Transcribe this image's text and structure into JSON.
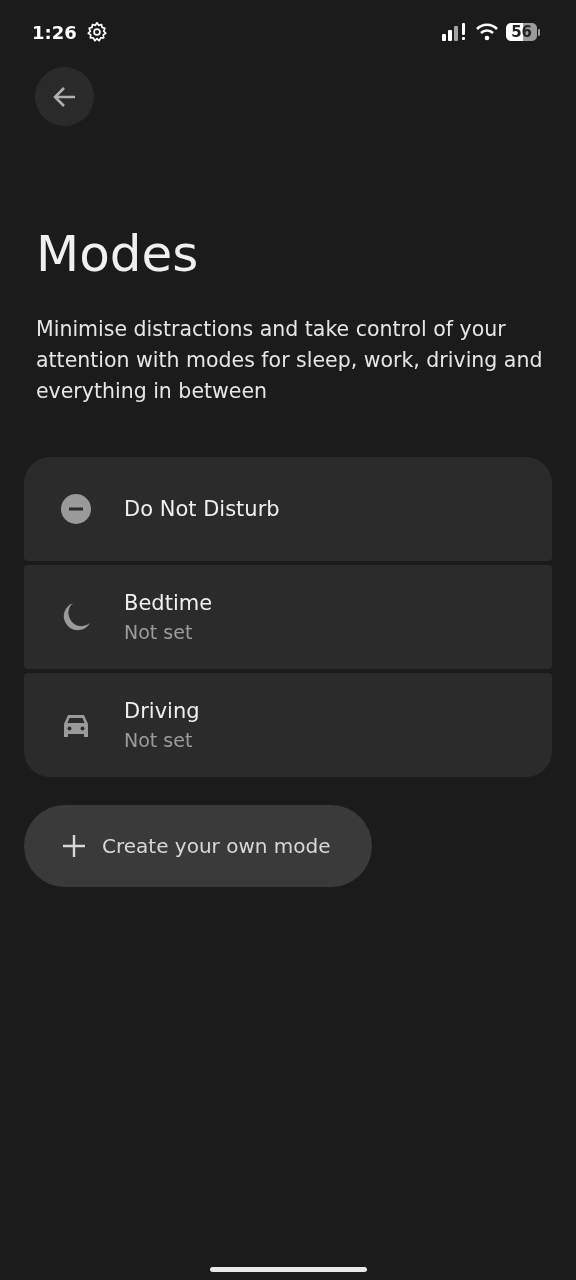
{
  "status_bar": {
    "time": "1:26",
    "battery": "56"
  },
  "title": "Modes",
  "description": "Minimise distractions and take control of your attention with modes for sleep, work, driving and everything in between",
  "modes": [
    {
      "kind": "dnd",
      "name": "Do Not Disturb"
    },
    {
      "kind": "moon",
      "name": "Bedtime",
      "status": "Not set"
    },
    {
      "kind": "car",
      "name": "Driving",
      "status": "Not set"
    }
  ],
  "create_button": {
    "label": "Create your own mode"
  }
}
